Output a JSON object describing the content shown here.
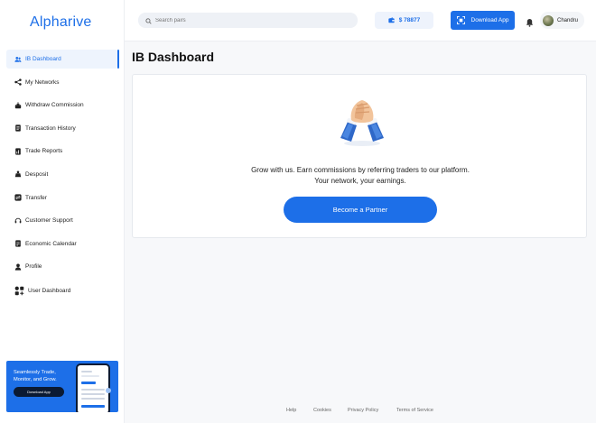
{
  "brand": {
    "name": "Alpharive",
    "accent": "#1d6fe8"
  },
  "sidebar": {
    "items": [
      {
        "label": "IB Dashboard",
        "icon": "users-icon",
        "active": true
      },
      {
        "label": "My Networks",
        "icon": "network-icon"
      },
      {
        "label": "Withdraw Commission",
        "icon": "withdraw-icon"
      },
      {
        "label": "Transaction History",
        "icon": "history-icon"
      },
      {
        "label": "Trade Reports",
        "icon": "report-icon"
      },
      {
        "label": "Desposit",
        "icon": "deposit-icon"
      },
      {
        "label": "Transfer",
        "icon": "transfer-icon"
      },
      {
        "label": "Customer Support",
        "icon": "headset-icon"
      },
      {
        "label": "Economic Calendar",
        "icon": "calendar-icon"
      },
      {
        "label": "Profile",
        "icon": "profile-icon"
      },
      {
        "label": "User Dashboard",
        "icon": "dashboard-grid-icon"
      }
    ],
    "promo": {
      "text": "Seamlessly Trade, Monitor, and Grow.",
      "button": "Download App"
    }
  },
  "header": {
    "search_placeholder": "Search pairs",
    "balance": "$ 78877",
    "download_label": "Download App",
    "user_name": "Chandru"
  },
  "main": {
    "title": "IB Dashboard",
    "tagline_1": "Grow with us. Earn commissions by referring traders to our platform.",
    "tagline_2": "Your network, your earnings.",
    "cta_label": "Become a Partner"
  },
  "footer": {
    "links": [
      "Help",
      "Cookies",
      "Privacy Policy",
      "Terms of Service"
    ]
  }
}
